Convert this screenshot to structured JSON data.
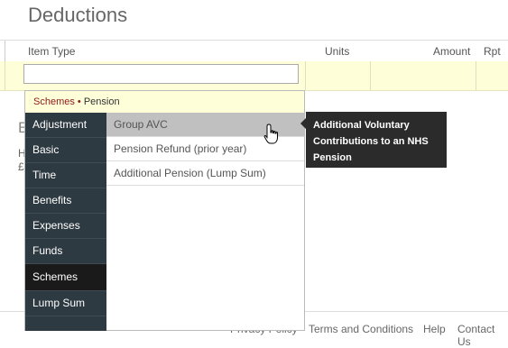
{
  "page": {
    "title": "Deductions"
  },
  "grid": {
    "headers": {
      "item_type": "Item Type",
      "units": "Units",
      "amount": "Amount",
      "rpt": "Rpt"
    },
    "item_input_value": ""
  },
  "background": {
    "section_initial": "E",
    "line1": "H",
    "line2": "£"
  },
  "dropdown": {
    "breadcrumb": {
      "parent": "Schemes",
      "separator": " • ",
      "current": "Pension"
    },
    "categories": [
      "Adjustment",
      "Basic",
      "Time",
      "Benefits",
      "Expenses",
      "Funds",
      "Schemes",
      "Lump Sum"
    ],
    "active_category": "Schemes",
    "items": [
      "Group AVC",
      "Pension Refund (prior year)",
      "Additional Pension (Lump Sum)"
    ],
    "hovered_item": "Group AVC"
  },
  "tooltip": {
    "text": "Additional Voluntary Contributions to an NHS Pension"
  },
  "footer": {
    "privacy": "Privacy Policy",
    "terms": "Terms and Conditions",
    "help": "Help",
    "contact": "Contact Us"
  },
  "colors": {
    "highlight_row": "#fefed8",
    "category_bg": "#2e3a41",
    "category_active": "#1a1a1a",
    "breadcrumb_parent": "#8b1a1a",
    "hover_item": "#c0c0c0",
    "tooltip_bg": "#2b2b2b"
  },
  "icons": {
    "cursor": "hand-pointer-icon"
  }
}
